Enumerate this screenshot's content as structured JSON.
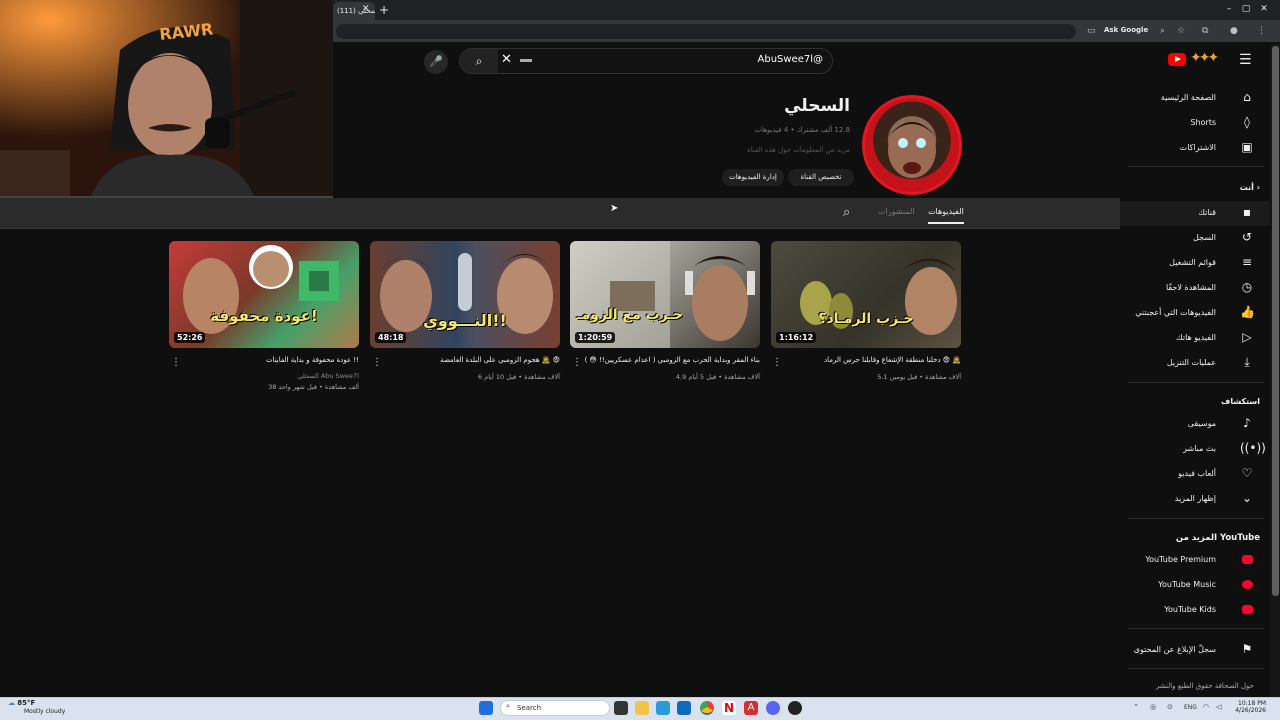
{
  "browser": {
    "tab_title": "(111) السحلي",
    "ask_google": "Ask Google"
  },
  "masthead": {
    "search_query": "AbuSwee7l@"
  },
  "channel": {
    "name": "السحلي",
    "meta": "‏12.8 ألف مشترك • 4 فيديوهات",
    "description": "مزيد من المعلومات حول هذه القناة",
    "customize_label": "تخصيص القناة",
    "manage_label": "إدارة الفيديوهات"
  },
  "channel_tabs": {
    "videos": "الفيديوهات",
    "posts": "المنشورات"
  },
  "videos": [
    {
      "title": "دخلنا منطقة الإشعاع وقابلنا حرس الرماد 😨 🧟",
      "duration": "1:16:12",
      "meta": "5.1 آلاف مشاهدة • قبل يومين",
      "overlay": "حـزب الرمـاد؟"
    },
    {
      "title": "بناء المقر وبداية الحرب مع الزومبي ( اعدام عسكريين!! 😳 )",
      "duration": "1:20:59",
      "meta": "4.9 آلاف مشاهدة • قبل 5 أيام",
      "overlay": "حـرب مع الزومـ"
    },
    {
      "title": "هجوم الزومبي على البلدة الغامضة 🧟 😨",
      "duration": "48:18",
      "meta": "6 آلاف مشاهدة • قبل 10 أيام",
      "overlay": "النـــووي!!"
    },
    {
      "title": "عودة محفوفة و بداية الفايتات !!",
      "duration": "52:26",
      "meta": "38 ألف مشاهدة • قبل شهر واحد",
      "channel": "السحلي Abu Swee7l",
      "overlay": "عودة محفوفة!"
    }
  ],
  "sidebar": {
    "main": [
      {
        "label": "الصفحة الرئيسية",
        "icon": "home-icon"
      },
      {
        "label": "Shorts",
        "icon": "shorts-icon"
      },
      {
        "label": "الاشتراكات",
        "icon": "subscriptions-icon"
      }
    ],
    "you_heading": "أنت",
    "you": [
      {
        "label": "قناتك",
        "icon": "your-channel-icon"
      },
      {
        "label": "السجل",
        "icon": "history-icon"
      },
      {
        "label": "قوائم التشغيل",
        "icon": "playlists-icon"
      },
      {
        "label": "المشاهدة لاحقًا",
        "icon": "watch-later-icon"
      },
      {
        "label": "الفيديوهات التي أعجبتني",
        "icon": "liked-icon"
      },
      {
        "label": "الفيديو هاتك",
        "icon": "your-videos-icon"
      },
      {
        "label": "عمليات التنزيل",
        "icon": "downloads-icon"
      }
    ],
    "explore_heading": "استكشاف",
    "explore": [
      {
        "label": "موسيقى",
        "icon": "music-icon"
      },
      {
        "label": "بث مباشر",
        "icon": "live-icon"
      },
      {
        "label": "ألعاب فيديو",
        "icon": "gaming-icon"
      },
      {
        "label": "إظهار المزيد",
        "icon": "chevron-down-icon"
      }
    ],
    "more_heading": "المزيد من YouTube",
    "more": [
      {
        "label": "YouTube Premium",
        "icon": "youtube-premium-icon"
      },
      {
        "label": "YouTube Music",
        "icon": "youtube-music-icon"
      },
      {
        "label": "YouTube Kids",
        "icon": "youtube-kids-icon"
      }
    ],
    "report_label": "سجلّ الإبلاغ عن المحتوى",
    "footer": "حول   الصحافة   حقوق الطبع والنشر"
  },
  "taskbar": {
    "weather_temp": "85°F",
    "weather_desc": "Mostly cloudy",
    "search_placeholder": "Search",
    "lang": "ENG",
    "time": "10:18 PM",
    "date": "4/26/2026"
  }
}
